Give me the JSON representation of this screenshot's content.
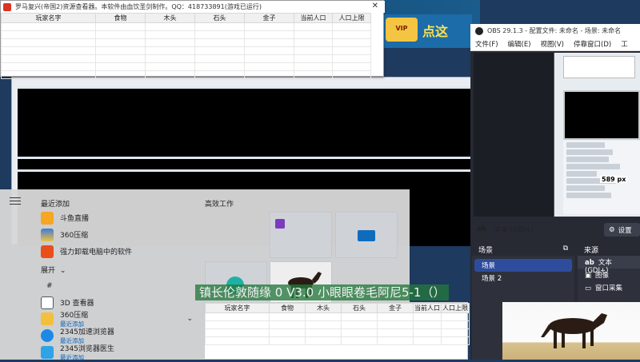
{
  "tool_window": {
    "title": "罗马复兴(帝国2)资源查看器。本软件由血饮圣剑制作。QQ：418733891(游戏已运行)",
    "close": "✕",
    "columns": [
      "玩家名字",
      "食物",
      "木头",
      "石头",
      "金子",
      "当前人口",
      "人口上限"
    ]
  },
  "game": {
    "banner_text": "点这",
    "vip_badge": "VIP"
  },
  "obs": {
    "title": "OBS 29.1.3 - 配置文件: 未命名 - 场景: 未命名",
    "menu": [
      "文件(F)",
      "编辑(E)",
      "视图(V)",
      "停靠窗口(D)",
      "工"
    ],
    "preview_px_label": "589 px",
    "source_selected": "文本 (GDI+)",
    "settings_button": "设置",
    "scenes_title": "场景",
    "scenes": [
      "场景",
      "场景 2"
    ],
    "sources_title": "来源",
    "sources": [
      "文本 (GDI+)",
      "图像",
      "窗口采集"
    ],
    "accent_color": "#2d4d9c"
  },
  "start_menu": {
    "recent_header": "最近添加",
    "recent_apps": [
      "斗鱼直播",
      "360压缩",
      "强力卸载电脑中的软件"
    ],
    "expand_label": "展开",
    "hash_label": "#",
    "all_apps": [
      {
        "name": "3D 查看器",
        "sub": ""
      },
      {
        "name": "360压缩",
        "sub": "最近添加"
      },
      {
        "name": "2345加速浏览器",
        "sub": "最近添加"
      },
      {
        "name": "2345浏览器医生",
        "sub": "最近添加"
      }
    ],
    "tiles_header": "高效工作"
  },
  "overlay_text": "镇长伦敦随缘 0 V3.0 小眼眼卷毛阿尼5-1（）",
  "lower_table_columns": [
    "玩家名字",
    "食物",
    "木头",
    "石头",
    "金子",
    "当前人口",
    "人口上限"
  ]
}
